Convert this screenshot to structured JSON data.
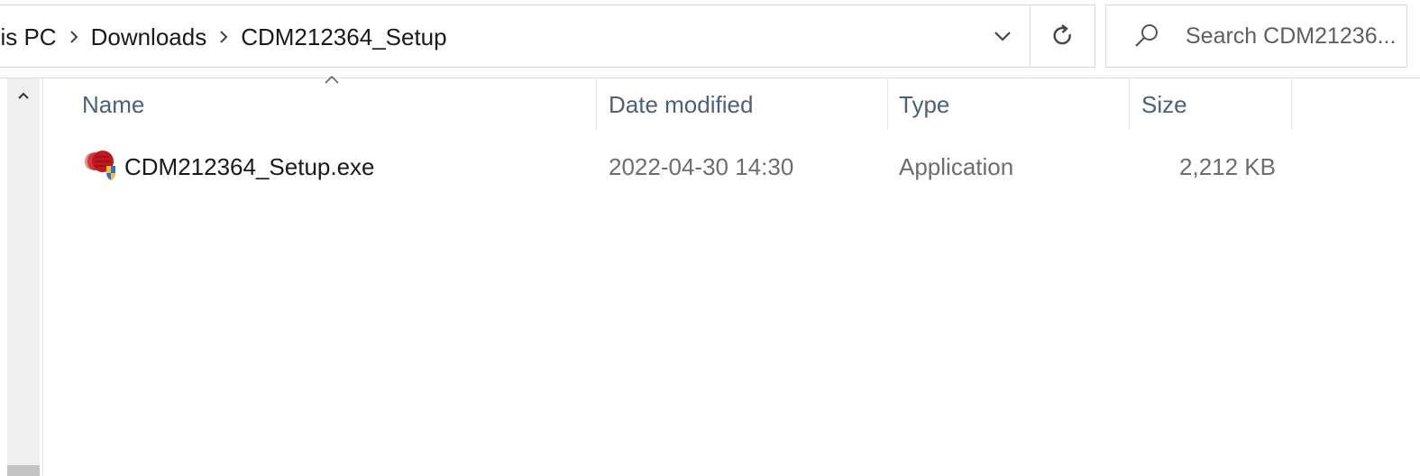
{
  "address_bar": {
    "breadcrumb": [
      "his PC",
      "Downloads",
      "CDM212364_Setup"
    ]
  },
  "search": {
    "placeholder": "Search CDM21236..."
  },
  "columns": {
    "name": "Name",
    "date_modified": "Date modified",
    "type": "Type",
    "size": "Size"
  },
  "files": [
    {
      "name": "CDM212364_Setup.exe",
      "date_modified": "2022-04-30 14:30",
      "type": "Application",
      "size": "2,212 KB",
      "icon": "installer-exe-icon"
    }
  ],
  "colors": {
    "header_text": "#4c607a",
    "secondary_text": "#6d6d6d",
    "border": "#d9d9d9"
  }
}
